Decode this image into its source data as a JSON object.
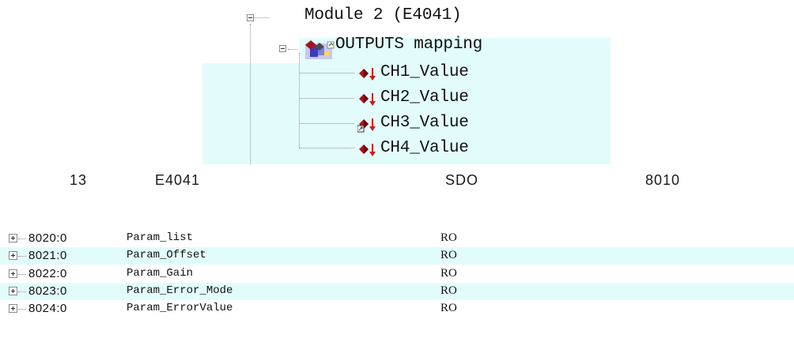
{
  "tree": {
    "module_label": "Module 2 (E4041)",
    "mapping_label": "OUTPUTS mapping",
    "channels": [
      {
        "label": "CH1_Value",
        "icon": "output-variable-icon",
        "linked": false
      },
      {
        "label": "CH2_Value",
        "icon": "output-variable-icon",
        "linked": false
      },
      {
        "label": "CH3_Value",
        "icon": "linked-output-variable-icon",
        "linked": true
      },
      {
        "label": "CH4_Value",
        "icon": "output-variable-icon",
        "linked": false
      }
    ]
  },
  "caption": {
    "number": "13",
    "module": "E4041",
    "protocol": "SDO",
    "index": "8010"
  },
  "object_list": {
    "rows": [
      {
        "index": "8020:0",
        "name": "Param_list",
        "flags": "RO"
      },
      {
        "index": "8021:0",
        "name": "Param_Offset",
        "flags": "RO"
      },
      {
        "index": "8022:0",
        "name": "Param_Gain",
        "flags": "RO"
      },
      {
        "index": "8023:0",
        "name": "Param_Error_Mode",
        "flags": "RO"
      },
      {
        "index": "8024:0",
        "name": "Param_ErrorValue",
        "flags": "RO"
      }
    ]
  },
  "colors": {
    "highlight": "#e2fcfc",
    "diamond": "#b3101c",
    "arrow": "#d11a1a"
  }
}
